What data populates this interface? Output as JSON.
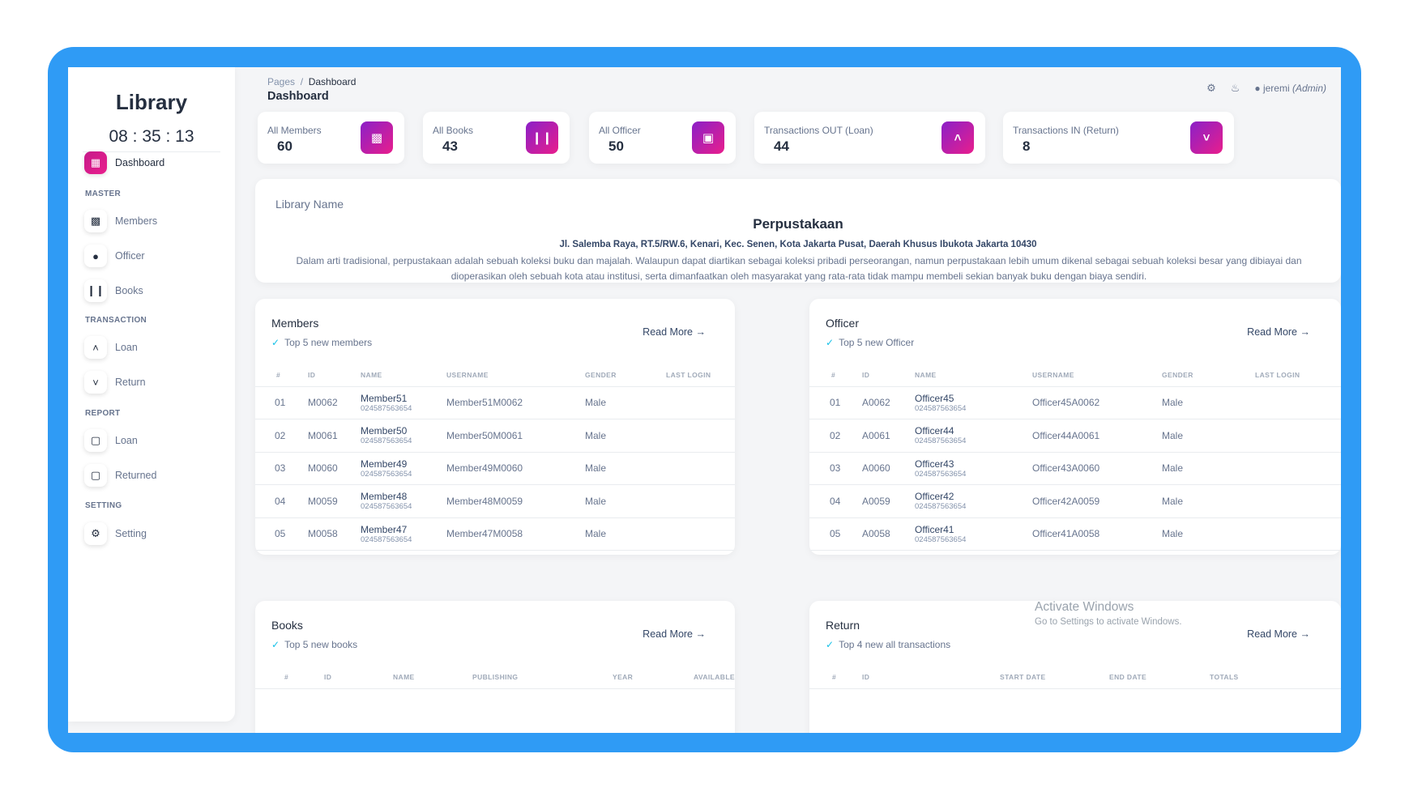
{
  "sidebar": {
    "brand": "Library",
    "clock": "08 : 35 : 13",
    "dashboard": "Dashboard",
    "sections": {
      "master": "MASTER",
      "transaction": "TRANSACTION",
      "report": "REPORT",
      "setting": "SETTING"
    },
    "items": {
      "members": "Members",
      "officer": "Officer",
      "books": "Books",
      "loan": "Loan",
      "return": "Return",
      "report_loan": "Loan",
      "report_returned": "Returned",
      "setting": "Setting"
    }
  },
  "header": {
    "breadcrumb_root": "Pages",
    "breadcrumb_sep": "/",
    "breadcrumb_current": "Dashboard",
    "title": "Dashboard",
    "user_name": "jeremi",
    "user_role": "(Admin)"
  },
  "stats": {
    "members": {
      "label": "All Members",
      "value": "60"
    },
    "books": {
      "label": "All Books",
      "value": "43"
    },
    "officer": {
      "label": "All Officer",
      "value": "50"
    },
    "out": {
      "label": "Transactions OUT (Loan)",
      "value": "44"
    },
    "in": {
      "label": "Transactions IN (Return)",
      "value": "8"
    }
  },
  "library": {
    "label": "Library Name",
    "name": "Perpustakaan",
    "address": "Jl. Salemba Raya, RT.5/RW.6, Kenari, Kec. Senen, Kota Jakarta Pusat, Daerah Khusus Ibukota Jakarta 10430",
    "description": "Dalam arti tradisional, perpustakaan adalah sebuah koleksi buku dan majalah. Walaupun dapat diartikan sebagai koleksi pribadi perseorangan, namun perpustakaan lebih umum dikenal sebagai sebuah koleksi besar yang dibiayai dan dioperasikan oleh sebuah kota atau institusi, serta dimanfaatkan oleh masyarakat yang rata-rata tidak mampu membeli sekian banyak buku dengan biaya sendiri."
  },
  "read_more": "Read More",
  "members_card": {
    "title": "Members",
    "subtitle": "Top 5 new members",
    "columns": [
      "#",
      "ID",
      "NAME",
      "USERNAME",
      "GENDER",
      "LAST LOGIN"
    ],
    "rows": [
      {
        "no": "01",
        "id": "M0062",
        "name": "Member51",
        "phone": "024587563654",
        "username": "Member51M0062",
        "gender": "Male"
      },
      {
        "no": "02",
        "id": "M0061",
        "name": "Member50",
        "phone": "024587563654",
        "username": "Member50M0061",
        "gender": "Male"
      },
      {
        "no": "03",
        "id": "M0060",
        "name": "Member49",
        "phone": "024587563654",
        "username": "Member49M0060",
        "gender": "Male"
      },
      {
        "no": "04",
        "id": "M0059",
        "name": "Member48",
        "phone": "024587563654",
        "username": "Member48M0059",
        "gender": "Male"
      },
      {
        "no": "05",
        "id": "M0058",
        "name": "Member47",
        "phone": "024587563654",
        "username": "Member47M0058",
        "gender": "Male"
      }
    ]
  },
  "officer_card": {
    "title": "Officer",
    "subtitle": "Top 5 new Officer",
    "columns": [
      "#",
      "ID",
      "NAME",
      "USERNAME",
      "GENDER",
      "LAST LOGIN"
    ],
    "rows": [
      {
        "no": "01",
        "id": "A0062",
        "name": "Officer45",
        "phone": "024587563654",
        "username": "Officer45A0062",
        "gender": "Male"
      },
      {
        "no": "02",
        "id": "A0061",
        "name": "Officer44",
        "phone": "024587563654",
        "username": "Officer44A0061",
        "gender": "Male"
      },
      {
        "no": "03",
        "id": "A0060",
        "name": "Officer43",
        "phone": "024587563654",
        "username": "Officer43A0060",
        "gender": "Male"
      },
      {
        "no": "04",
        "id": "A0059",
        "name": "Officer42",
        "phone": "024587563654",
        "username": "Officer42A0059",
        "gender": "Male"
      },
      {
        "no": "05",
        "id": "A0058",
        "name": "Officer41",
        "phone": "024587563654",
        "username": "Officer41A0058",
        "gender": "Male"
      }
    ]
  },
  "books_card": {
    "title": "Books",
    "subtitle": "Top 5 new books",
    "columns": [
      "#",
      "ID",
      "NAME",
      "PUBLISHING",
      "YEAR",
      "AVAILABLE"
    ]
  },
  "return_card": {
    "title": "Return",
    "subtitle": "Top 4 new all transactions",
    "columns": [
      "#",
      "ID",
      "START DATE",
      "END DATE",
      "TOTALS"
    ]
  },
  "watermark": {
    "line1": "Activate Windows",
    "line2": "Go to Settings to activate Windows."
  },
  "colors": {
    "frame": "#2f9bf5",
    "accent_gradient_start": "#8a20c8",
    "accent_gradient_end": "#e91e8c",
    "check": "#17c1e8"
  }
}
